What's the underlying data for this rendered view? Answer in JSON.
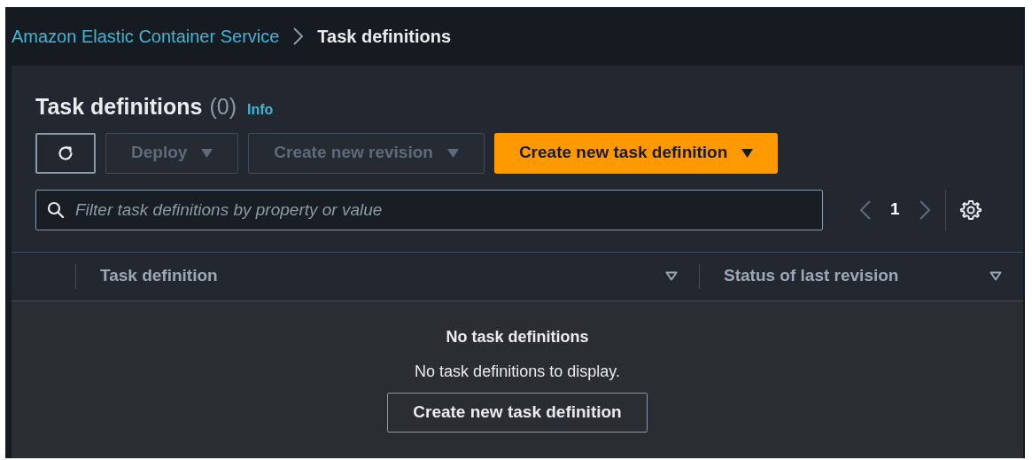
{
  "breadcrumb": [
    {
      "label": "Amazon Elastic Container Service",
      "kind": "link"
    },
    {
      "label": "Task definitions",
      "kind": "current"
    }
  ],
  "header": {
    "title": "Task definitions",
    "count": "(0)",
    "info": "Info"
  },
  "toolbar": [
    {
      "kind": "refresh",
      "disabled": false
    },
    {
      "kind": "dropdown",
      "label": "Deploy",
      "disabled": true
    },
    {
      "kind": "dropdown",
      "label": "Create new revision",
      "disabled": true
    },
    {
      "kind": "primary",
      "label": "Create new task definition",
      "disabled": false
    }
  ],
  "filter": {
    "placeholder": "Filter task definitions by property or value"
  },
  "pagination": {
    "page": "1"
  },
  "table": {
    "columns": [
      "Task definition",
      "Status of last revision"
    ]
  },
  "empty_state": {
    "title": "No task definitions",
    "message": "No task definitions to display.",
    "button": "Create new task definition"
  }
}
